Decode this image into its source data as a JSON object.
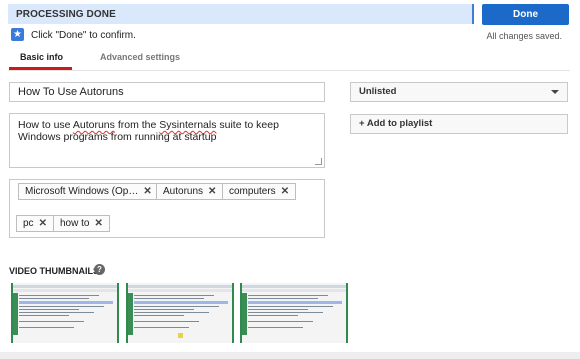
{
  "header": {
    "status": "PROCESSING DONE",
    "done_label": "Done",
    "saved_text": "All changes saved."
  },
  "confirm": {
    "text": "Click \"Done\" to confirm."
  },
  "tabs": [
    {
      "label": "Basic info",
      "active": true
    },
    {
      "label": "Advanced settings",
      "active": false
    }
  ],
  "form": {
    "title": "How To Use Autoruns",
    "description": {
      "part1": "How to use ",
      "word1": "Autoruns",
      "part2": " from the ",
      "word2": "Sysinternals",
      "part3": " suite to keep Windows programs from running at startup"
    },
    "tags": [
      "Microsoft Windows (Op…",
      "Autoruns",
      "computers",
      "pc",
      "how to"
    ],
    "tag_remove": "✕"
  },
  "sidebar": {
    "privacy": "Unlisted",
    "playlist": "+ Add to playlist"
  },
  "thumbnails": {
    "label": "VIDEO THUMBNAILS",
    "help": "?",
    "items": [
      "thumbnail-1",
      "thumbnail-2",
      "thumbnail-3"
    ]
  },
  "colors": {
    "accent": "#1b6ac9",
    "tab_active": "#cc181e",
    "status_bg": "#d9e8fb"
  }
}
